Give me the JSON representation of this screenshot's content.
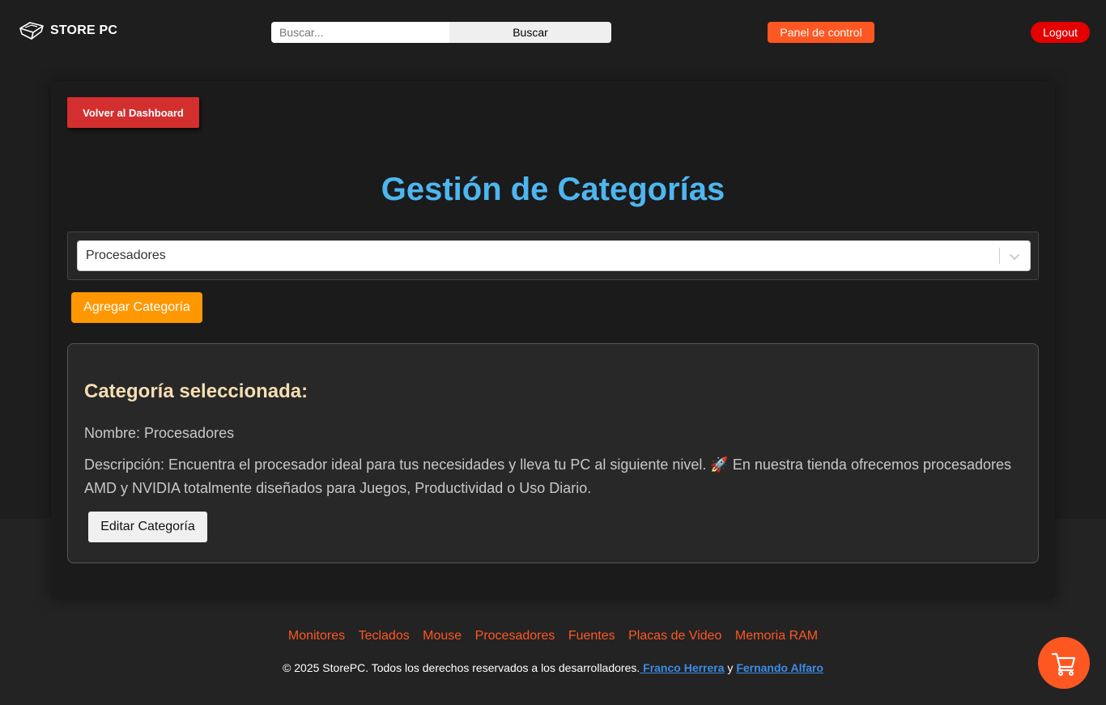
{
  "header": {
    "brand": "STORE PC",
    "search_placeholder": "Buscar...",
    "search_button": "Buscar",
    "panel_button": "Panel de control",
    "logout_button": "Logout"
  },
  "main": {
    "back_button": "Volver al Dashboard",
    "title": "Gestión de Categorías",
    "selected_option": "Procesadores",
    "add_button": "Agregar Categoría",
    "card": {
      "title": "Categoría seleccionada:",
      "name_line": "Nombre: Procesadores",
      "description_line": "Descripción: Encuentra el procesador ideal para tus necesidades y lleva tu PC al siguiente nivel. 🚀 En nuestra tienda ofrecemos procesadores AMD y NVIDIA totalmente diseñados para Juegos, Productividad o Uso Diario.",
      "edit_button": "Editar Categoría"
    }
  },
  "footer": {
    "links": [
      "Monitores",
      "Teclados",
      "Mouse",
      "Procesadores",
      "Fuentes",
      "Placas de Video",
      "Memoria RAM"
    ],
    "copyright_text": "© 2025 StorePC. Todos los derechos reservados a los desarrolladores.",
    "author_1": " Franco Herrera",
    "connector": " y ",
    "author_2": "Fernando Alfaro"
  },
  "icons": {
    "logo": "keycap-logo-icon",
    "select": "chevron-down-icon",
    "cart": "shopping-cart-icon"
  },
  "colors": {
    "accent_orange": "#ff5722",
    "title_blue": "#4db6f0",
    "logout_red": "#e50000",
    "back_red": "#d32f2f",
    "add_orange": "#ff9800"
  }
}
